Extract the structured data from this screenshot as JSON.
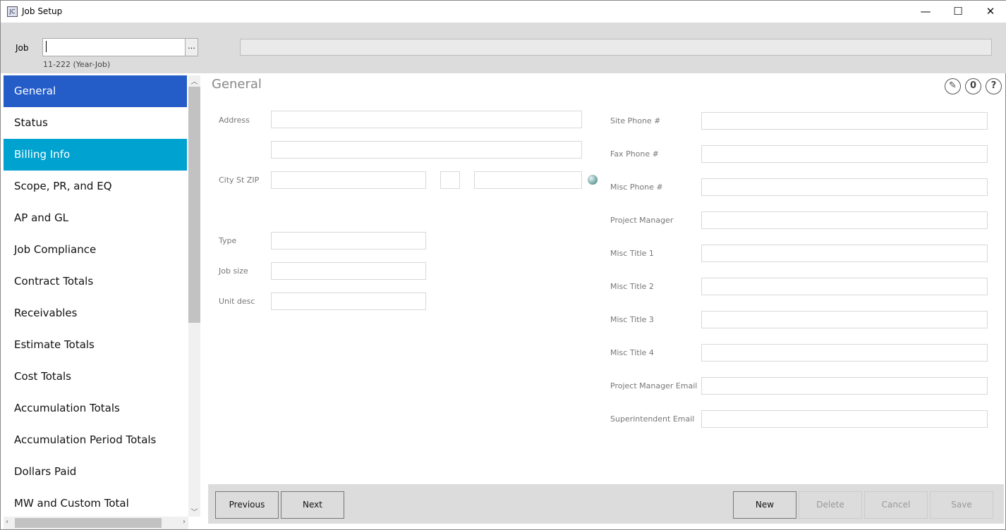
{
  "window": {
    "title": "Job Setup",
    "icon_text": "JC",
    "minimize": "—",
    "maximize": "☐",
    "close": "✕"
  },
  "header": {
    "job_label": "Job",
    "job_value": "",
    "lookup_label": "...",
    "hint": "11-222 (Year-Job)"
  },
  "sidebar": {
    "items": [
      {
        "label": "General",
        "state": "selected"
      },
      {
        "label": "Status"
      },
      {
        "label": "Billing Info",
        "state": "highlighted"
      },
      {
        "label": "Scope, PR, and EQ"
      },
      {
        "label": "AP and GL"
      },
      {
        "label": "Job Compliance"
      },
      {
        "label": "Contract Totals"
      },
      {
        "label": "Receivables"
      },
      {
        "label": "Estimate Totals"
      },
      {
        "label": "Cost Totals"
      },
      {
        "label": "Accumulation Totals"
      },
      {
        "label": "Accumulation Period Totals"
      },
      {
        "label": "Dollars Paid"
      },
      {
        "label": "MW and Custom Total"
      }
    ]
  },
  "main": {
    "title": "General",
    "icons": [
      "edit-icon",
      "attachment-icon",
      "help-icon"
    ],
    "left_fields": {
      "address": "Address",
      "city": "City St ZIP",
      "type": "Type",
      "job_size": "Job size",
      "unit_desc": "Unit desc"
    },
    "right_fields": [
      "Site Phone #",
      "Fax Phone #",
      "Misc Phone #",
      "Project Manager",
      "Misc Title 1",
      "Misc Title 2",
      "Misc Title 3",
      "Misc Title 4",
      "Project Manager Email",
      "Superintendent Email"
    ]
  },
  "footer": {
    "previous": "Previous",
    "next": "Next",
    "new": "New",
    "delete": "Delete",
    "cancel": "Cancel",
    "save": "Save"
  },
  "colors": {
    "selected": "#245cc8",
    "highlighted": "#00a2d0"
  }
}
